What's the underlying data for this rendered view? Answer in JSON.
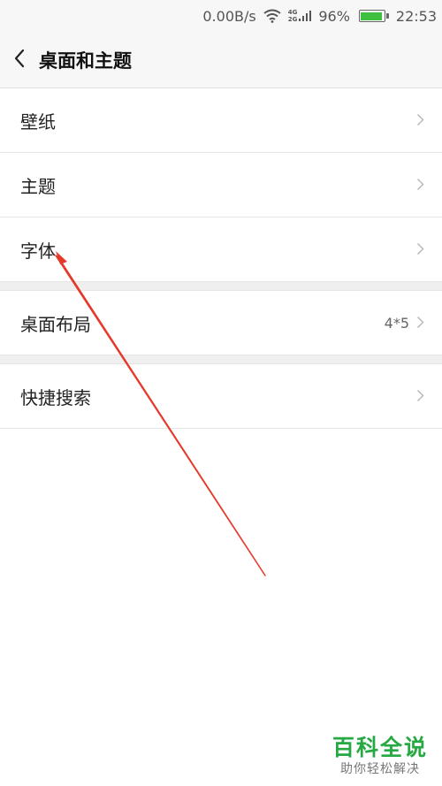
{
  "status_bar": {
    "net_speed": "0.00B/s",
    "net_4g": "4G",
    "net_2g": "2G",
    "battery_percent": "96%",
    "battery_level": 0.96,
    "time": "22:53",
    "icons": [
      "wifi-icon",
      "signal-icon",
      "battery-icon"
    ]
  },
  "header": {
    "back_icon": "chevron-left-icon",
    "title": "桌面和主题"
  },
  "groups": [
    {
      "items": [
        {
          "label": "壁纸",
          "value": ""
        },
        {
          "label": "主题",
          "value": ""
        },
        {
          "label": "字体",
          "value": ""
        }
      ]
    },
    {
      "items": [
        {
          "label": "桌面布局",
          "value": "4*5"
        }
      ]
    },
    {
      "items": [
        {
          "label": "快捷搜索",
          "value": ""
        }
      ]
    }
  ],
  "annotation": {
    "color": "#e53a2b",
    "target": "字体"
  },
  "watermark": {
    "title": "百科全说",
    "subtitle": "助你轻松解决",
    "color": "#26a843"
  }
}
